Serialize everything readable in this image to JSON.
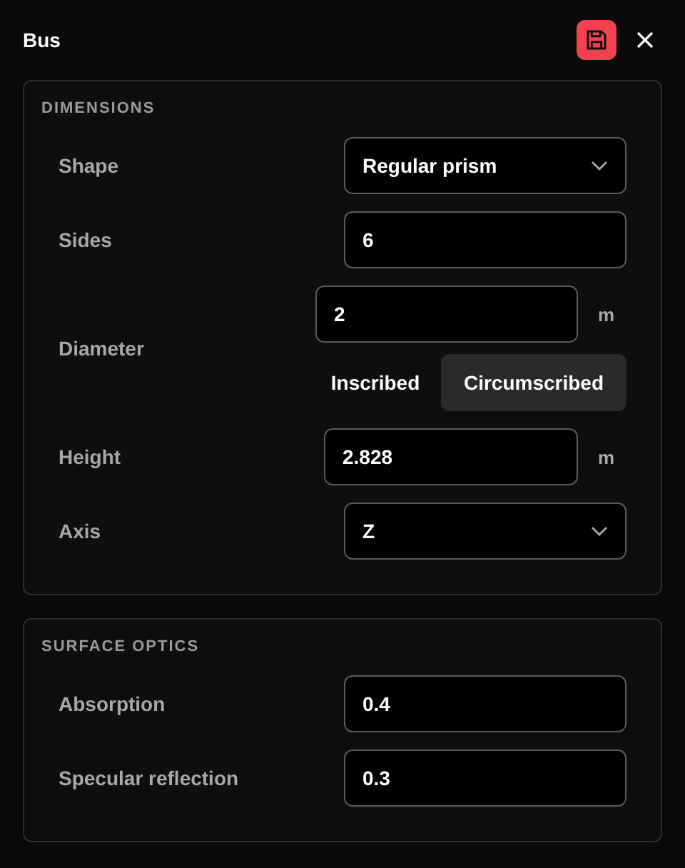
{
  "window": {
    "title": "Bus"
  },
  "sections": [
    {
      "title": "DIMENSIONS",
      "rows": [
        {
          "kind": "select",
          "label": "Shape",
          "value": "Regular prism"
        },
        {
          "kind": "number",
          "label": "Sides",
          "value": "6"
        },
        {
          "kind": "diameter",
          "label": "Diameter",
          "value": "2",
          "unit": "m",
          "options": [
            {
              "label": "Inscribed",
              "selected": false
            },
            {
              "label": "Circumscribed",
              "selected": true
            }
          ]
        },
        {
          "kind": "number",
          "label": "Height",
          "value": "2.828",
          "unit": "m"
        },
        {
          "kind": "select",
          "label": "Axis",
          "value": "Z"
        }
      ]
    },
    {
      "title": "SURFACE OPTICS",
      "rows": [
        {
          "kind": "number",
          "label": "Absorption",
          "value": "0.4"
        },
        {
          "kind": "number",
          "label": "Specular reflection",
          "value": "0.3"
        }
      ]
    }
  ]
}
